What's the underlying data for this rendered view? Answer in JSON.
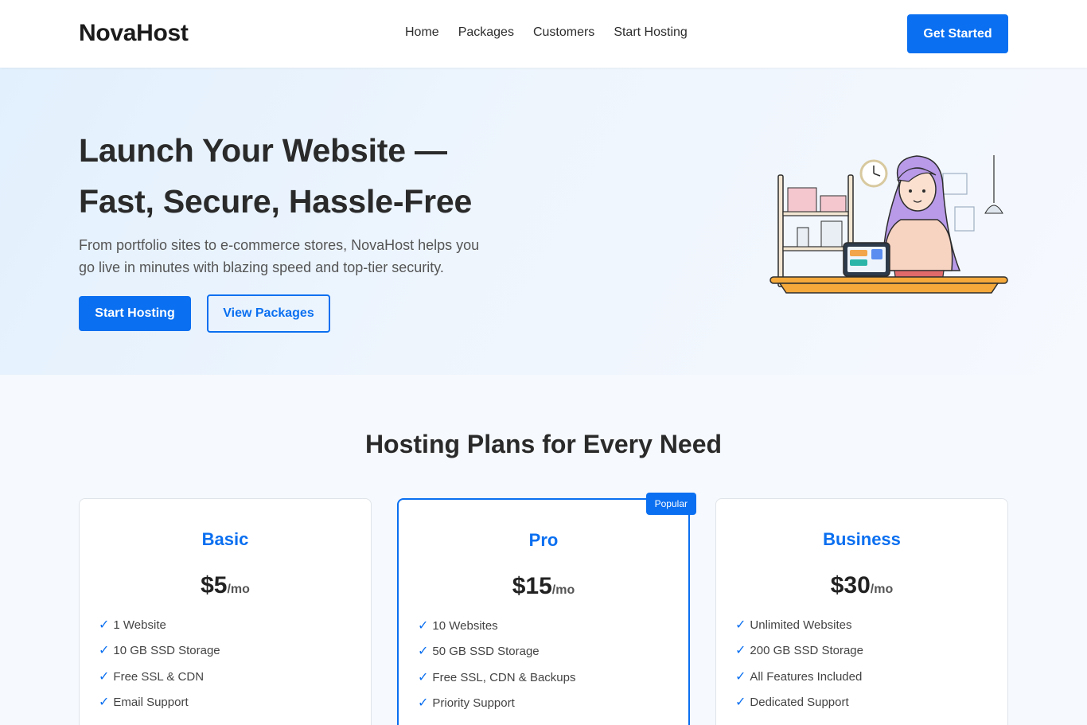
{
  "brand": "NovaHost",
  "nav": [
    "Home",
    "Packages",
    "Customers",
    "Start Hosting"
  ],
  "header_cta": "Get Started",
  "hero": {
    "title_line1": "Launch Your Website —",
    "title_line2": "Fast, Secure, Hassle-Free",
    "subtitle": "From portfolio sites to e-commerce stores, NovaHost helps you go live in minutes with blazing speed and top-tier security.",
    "primary_button": "Start Hosting",
    "secondary_button": "View Packages"
  },
  "plans": {
    "title": "Hosting Plans for Every Need",
    "items": [
      {
        "name": "Basic",
        "price": "$5",
        "period": "/mo",
        "features": [
          "1 Website",
          "10 GB SSD Storage",
          "Free SSL & CDN",
          "Email Support"
        ]
      },
      {
        "name": "Pro",
        "price": "$15",
        "period": "/mo",
        "badge": "Popular",
        "features": [
          "10 Websites",
          "50 GB SSD Storage",
          "Free SSL, CDN & Backups",
          "Priority Support"
        ]
      },
      {
        "name": "Business",
        "price": "$30",
        "period": "/mo",
        "features": [
          "Unlimited Websites",
          "200 GB SSD Storage",
          "All Features Included",
          "Dedicated Support"
        ]
      }
    ]
  },
  "colors": {
    "accent": "#0a6ff0",
    "text": "#2a2a2a",
    "hero_bg": "#e8f2fd"
  },
  "icons": {
    "feature_check": "✓"
  }
}
